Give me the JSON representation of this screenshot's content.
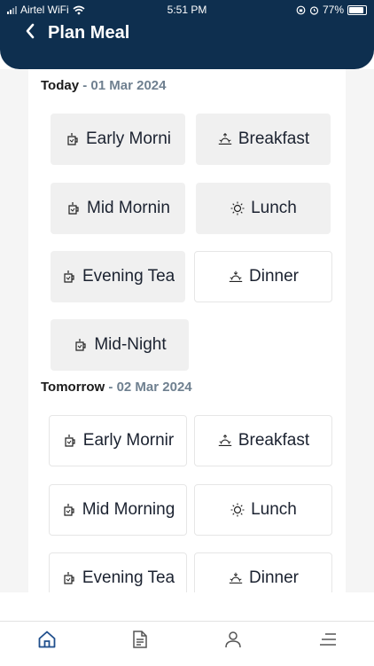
{
  "status_bar": {
    "carrier": "Airtel WiFi",
    "time": "5:51 PM",
    "battery": "77%"
  },
  "header": {
    "title": "Plan Meal",
    "back_icon": "chevron-left-icon"
  },
  "days": [
    {
      "label": "Today",
      "separator": " - ",
      "date": "01 Mar 2024",
      "meals": [
        {
          "label": "Early Morni",
          "icon": "mug-icon"
        },
        {
          "label": "Breakfast",
          "icon": "sunrise-icon"
        },
        {
          "label": "Mid Mornin",
          "icon": "mug-icon"
        },
        {
          "label": "Lunch",
          "icon": "sun-icon"
        },
        {
          "label": "Evening Tea",
          "icon": "mug-icon"
        },
        {
          "label": "Dinner",
          "icon": "sunset-icon"
        },
        {
          "label": "Mid-Night",
          "icon": "mug-icon"
        }
      ]
    },
    {
      "label": "Tomorrow",
      "separator": " - ",
      "date": "02 Mar 2024",
      "meals": [
        {
          "label": "Early Mornir",
          "icon": "mug-icon"
        },
        {
          "label": "Breakfast",
          "icon": "sunrise-icon"
        },
        {
          "label": "Mid Morning",
          "icon": "mug-icon"
        },
        {
          "label": "Lunch",
          "icon": "sun-icon"
        },
        {
          "label": "Evening Tea",
          "icon": "mug-icon"
        },
        {
          "label": "Dinner",
          "icon": "sunset-icon"
        }
      ]
    }
  ],
  "bottom_nav": [
    {
      "name": "home-icon"
    },
    {
      "name": "document-icon"
    },
    {
      "name": "profile-icon"
    },
    {
      "name": "menu-icon"
    }
  ],
  "colors": {
    "header": "#0e2f4f",
    "tile_grey": "#f0f0f0",
    "date_text": "#6f8090"
  }
}
